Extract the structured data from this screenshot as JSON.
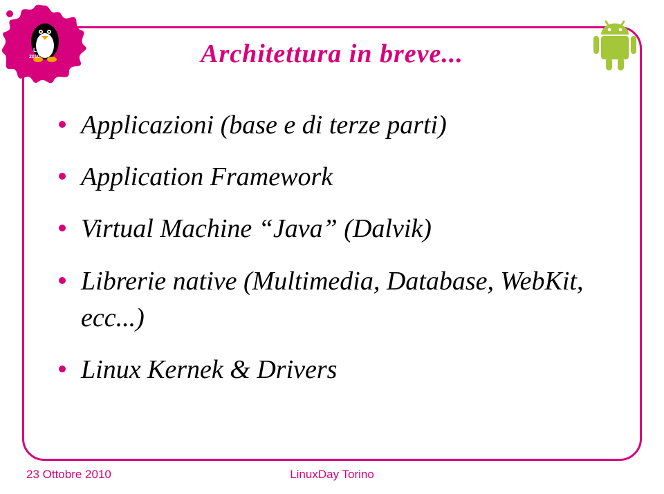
{
  "title": "Architettura in breve...",
  "bullets": [
    "Applicazioni (base e di terze parti)",
    "Application Framework",
    "Virtual Machine “Java” (Dalvik)",
    "Librerie native (Multimedia, Database, WebKit, ecc...)",
    "Linux Kernek & Drivers"
  ],
  "footer": {
    "date": "23 Ottobre 2010",
    "event": "LinuxDay Torino"
  },
  "colors": {
    "accent": "#d7017d",
    "android": "#a4c639"
  }
}
